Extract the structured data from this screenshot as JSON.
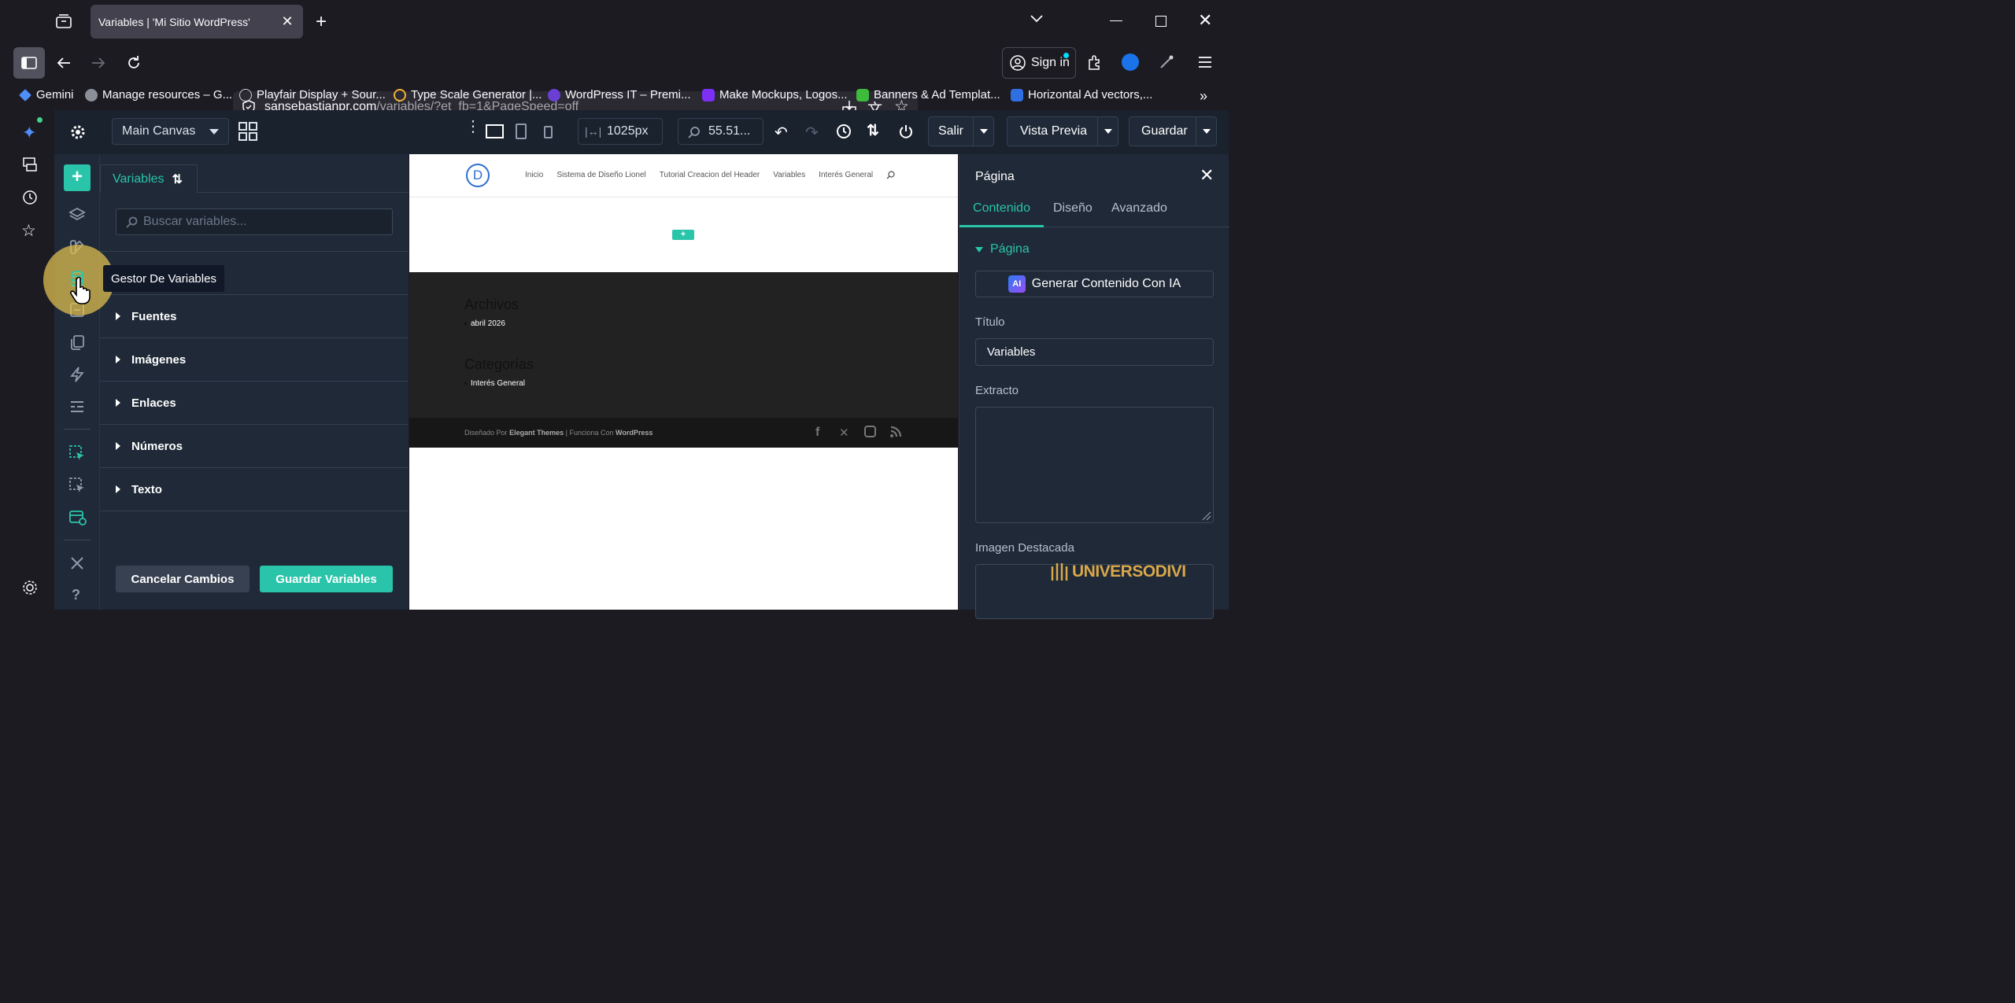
{
  "browser": {
    "tab_title": "Variables | 'Mi Sitio WordPress'",
    "url_host": "sansebastianpr.com",
    "url_path": "/variables/?et_fb=1&PageSpeed=off",
    "sign_in": "Sign in",
    "bookmarks": [
      {
        "label": "Gemini",
        "color": "#4f8ef7"
      },
      {
        "label": "Manage resources – G...",
        "color": "#8a8f98"
      },
      {
        "label": "Playfair Display + Sour...",
        "color": "#cfd2d6"
      },
      {
        "label": "Type Scale Generator |...",
        "color": "#f2b233"
      },
      {
        "label": "WordPress IT – Premi...",
        "color": "#6b3fd4"
      },
      {
        "label": "Make Mockups, Logos...",
        "color": "#7b2ff7"
      },
      {
        "label": "Banners & Ad Templat...",
        "color": "#3dbb3d"
      },
      {
        "label": "Horizontal Ad vectors,...",
        "color": "#2f6fe4"
      }
    ]
  },
  "divi": {
    "canvas_select": "Main Canvas",
    "width_value": "1025px",
    "zoom_value": "55.51...",
    "exit_button": "Salir",
    "preview_button": "Vista Previa",
    "save_button": "Guardar",
    "accent": "#29c4a9"
  },
  "variables_panel": {
    "tab_label": "Variables",
    "search_placeholder": "Buscar variables...",
    "tooltip": "Gestor De Variables",
    "groups": [
      "Fuentes",
      "Imágenes",
      "Enlaces",
      "Números",
      "Texto"
    ],
    "cancel_button": "Cancelar Cambios",
    "save_button": "Guardar Variables"
  },
  "site": {
    "logo_letter": "D",
    "nav": [
      "Inicio",
      "Sistema de Diseño Lionel",
      "Tutorial Creacion del Header",
      "Variables",
      "Interés General"
    ],
    "add_button": "+",
    "archives_title": "Archivos",
    "archives_item": "abril 2026",
    "categories_title": "Categorías",
    "categories_item": "Interés General",
    "footer_prefix": "Diseñado Por",
    "footer_brand": "Elegant Themes",
    "footer_mid": "| Funciona Con",
    "footer_wp": "WordPress"
  },
  "settings_panel": {
    "title": "Página",
    "tabs": [
      "Contenido",
      "Diseño",
      "Avanzado"
    ],
    "section": "Página",
    "ai_button": "Generar Contenido Con IA",
    "title_label": "Título",
    "title_value": "Variables",
    "excerpt_label": "Extracto",
    "featured_label": "Imagen Destacada",
    "watermark": "UNIVERSODIVI"
  }
}
